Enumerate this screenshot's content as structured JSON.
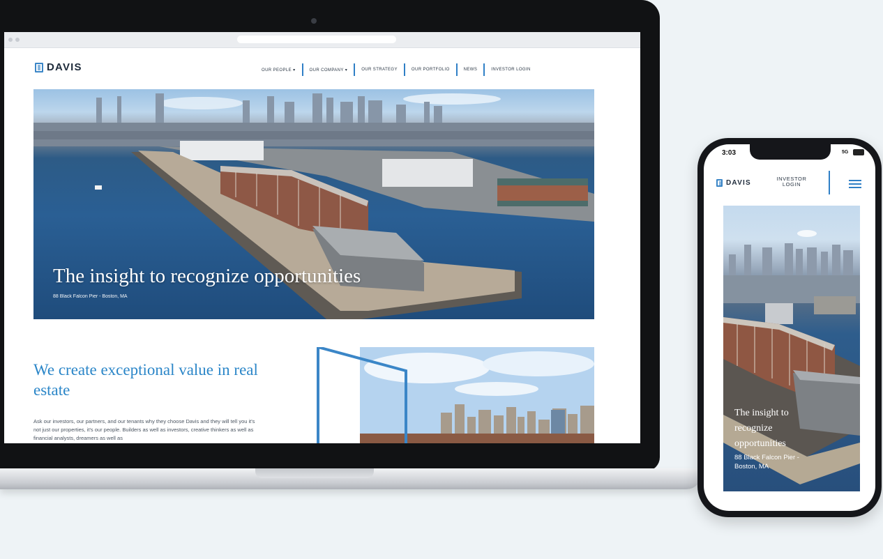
{
  "desktop": {
    "brand": "DAVIS",
    "nav": [
      {
        "label": "OUR PEOPLE",
        "dropdown": true
      },
      {
        "label": "OUR COMPANY",
        "dropdown": true
      },
      {
        "label": "OUR STRATEGY",
        "dropdown": false
      },
      {
        "label": "OUR PORTFOLIO",
        "dropdown": false
      },
      {
        "label": "NEWS",
        "dropdown": false
      },
      {
        "label": "INVESTOR LOGIN",
        "dropdown": false
      }
    ],
    "hero": {
      "title": "The insight to recognize opportunities",
      "caption": "88 Black Falcon Pier - Boston, MA"
    },
    "value": {
      "title": "We create exceptional value in real estate",
      "body": "Ask our investors, our partners, and our tenants why they choose Davis and they will tell you it's not just our properties, it's our people. Builders as well as investors, creative thinkers as well as financial analysts, dreamers as well as"
    }
  },
  "mobile": {
    "time": "3:03",
    "network": "5G",
    "brand": "DAVIS",
    "investor_login": "INVESTOR LOGIN",
    "hero": {
      "title": "The insight to recognize opportunities",
      "caption": "88 Black Falcon Pier - Boston, MA"
    }
  },
  "colors": {
    "accent": "#2b86c8",
    "nav_separator": "#2f7fc6",
    "bezel": "#111214",
    "background": "#eef3f6"
  },
  "icons": {
    "logo": "davis-logo-mark-icon",
    "dropdown": "chevron-down-icon",
    "menu": "hamburger-menu-icon"
  }
}
